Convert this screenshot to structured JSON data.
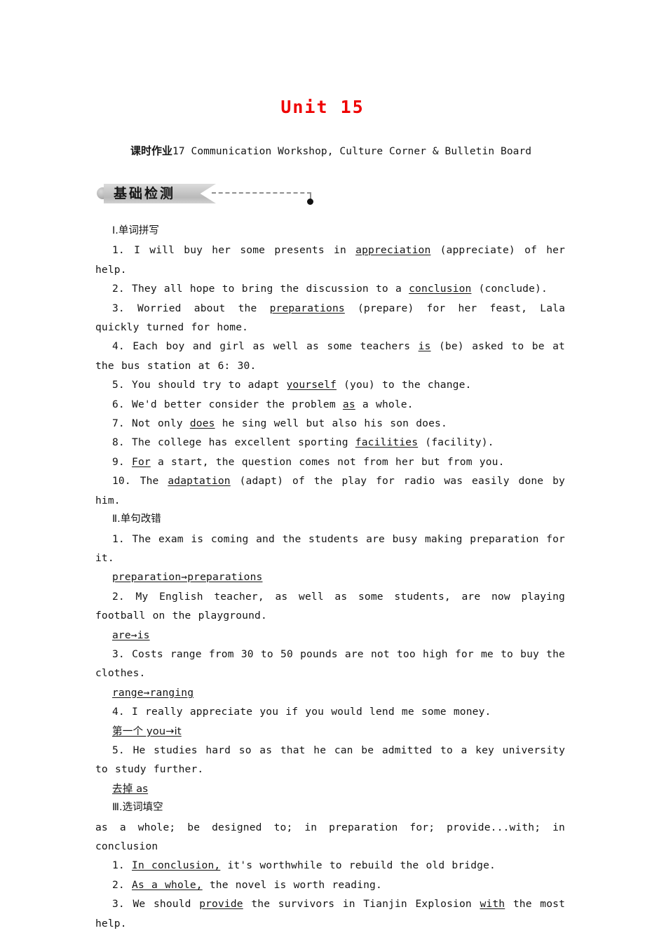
{
  "document": {
    "unit_title": "Unit 15",
    "assignment_prefix_cn": "课时作业",
    "assignment_title_en": "17 Communication Workshop, Culture Corner & Bulletin Board",
    "banner_label": "基础检测",
    "accent_color": "#ef0000",
    "banner_color": "#c8c8c8"
  },
  "sections": [
    {
      "heading": "Ⅰ.单词拼写",
      "numeral": "Ⅰ",
      "heading_cn": ".单词拼写",
      "items": [
        {
          "num": "1.",
          "pre": "I will buy her some presents in ",
          "answer": "appreciation",
          "post": " (appreciate) of her help."
        },
        {
          "num": "2.",
          "pre": "They all hope to bring the discussion to a ",
          "answer": "conclusion",
          "post": " (conclude)."
        },
        {
          "num": "3.",
          "pre": "Worried about the ",
          "answer": "preparations",
          "post": " (prepare) for her feast, Lala quickly turned for home."
        },
        {
          "num": "4.",
          "pre": "Each boy and girl as well as some teachers ",
          "answer": "is",
          "post": " (be) asked to be at the bus station at 6: 30."
        },
        {
          "num": "5.",
          "pre": "You should try to adapt ",
          "answer": "yourself",
          "post": " (you) to the change."
        },
        {
          "num": "6.",
          "pre": "We'd better consider the problem ",
          "answer": "as",
          "post": " a whole."
        },
        {
          "num": "7.",
          "pre": "Not only ",
          "answer": "does",
          "post": " he sing well but also his son does."
        },
        {
          "num": "8.",
          "pre": "The college has excellent sporting ",
          "answer": "facilities",
          "post": " (facility)."
        },
        {
          "num": "9.",
          "pre": "",
          "answer": "For",
          "post": " a start, the question comes not from her but from you."
        },
        {
          "num": "10.",
          "pre": "The ",
          "answer": "adaptation",
          "post": " (adapt) of the play for radio was easily done by him."
        }
      ]
    },
    {
      "heading": "Ⅱ.单句改错",
      "numeral": "Ⅱ",
      "heading_cn": ".单句改错",
      "items": [
        {
          "num": "1.",
          "sentence": "The exam is coming and the students are busy making preparation for it.",
          "answer": "preparation→preparations"
        },
        {
          "num": "2.",
          "sentence": "My English teacher, as well as some students, are now playing football on the playground.",
          "answer": "are→is"
        },
        {
          "num": "3.",
          "sentence": "Costs range from 30 to 50 pounds are not too high for me to buy the clothes.",
          "answer": "range→ranging"
        },
        {
          "num": "4.",
          "sentence": "I really appreciate you if you would lend me some money.",
          "answer": "第一个 you→it"
        },
        {
          "num": "5.",
          "sentence": "He studies hard so as that he can be admitted to a key university to study further.",
          "answer": "去掉 as"
        }
      ]
    },
    {
      "heading": "Ⅲ.选词填空",
      "numeral": "Ⅲ",
      "heading_cn": ".选词填空",
      "word_bank": "as a whole; be designed to; in preparation for; provide...with; in conclusion",
      "items": [
        {
          "num": "1.",
          "pre": "",
          "answer": "In conclusion,",
          "post": " it's worthwhile to rebuild the old bridge."
        },
        {
          "num": "2.",
          "pre": "",
          "answer": "As a whole,",
          "post": " the novel is worth reading."
        },
        {
          "num": "3.",
          "pre": "We should ",
          "answer": "provide",
          "post": " the survivors in Tianjin Explosion ",
          "answer2": "with",
          "post2": " the most help."
        }
      ]
    }
  ]
}
